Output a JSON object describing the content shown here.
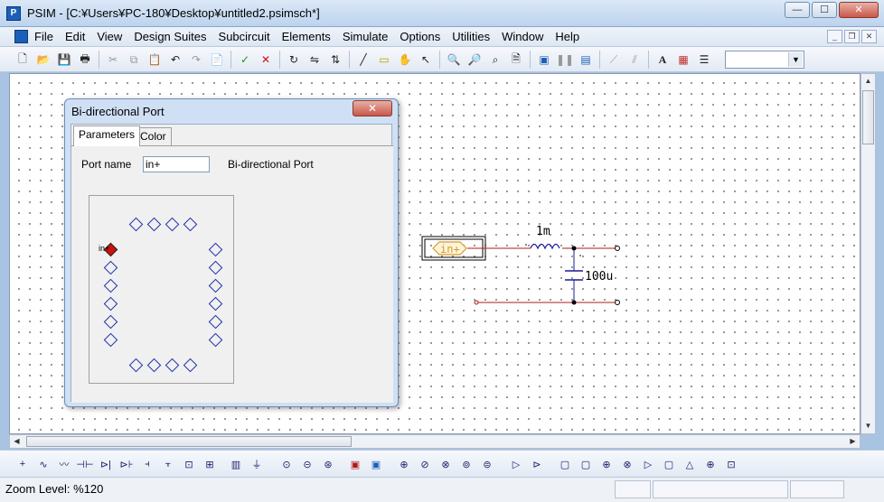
{
  "window": {
    "title": "PSIM - [C:¥Users¥PC-180¥Desktop¥untitled2.psimsch*]",
    "minimize": "—",
    "maximize": "☐",
    "close": "✕"
  },
  "menu": {
    "items": [
      "File",
      "Edit",
      "View",
      "Design Suites",
      "Subcircuit",
      "Elements",
      "Simulate",
      "Options",
      "Utilities",
      "Window",
      "Help"
    ]
  },
  "toolbar": {
    "combo_value": ""
  },
  "dialog": {
    "title": "Bi-directional Port",
    "close": "✕",
    "tabs": [
      "Parameters",
      "Color"
    ],
    "port_name_label": "Port name",
    "port_name_value": "in+",
    "description": "Bi-directional Port",
    "selected_pin_label": "in+"
  },
  "schematic": {
    "port_label": "in+",
    "inductor_value": "1m",
    "capacitor_value": "100u"
  },
  "status": {
    "zoom": "Zoom Level: %120"
  }
}
